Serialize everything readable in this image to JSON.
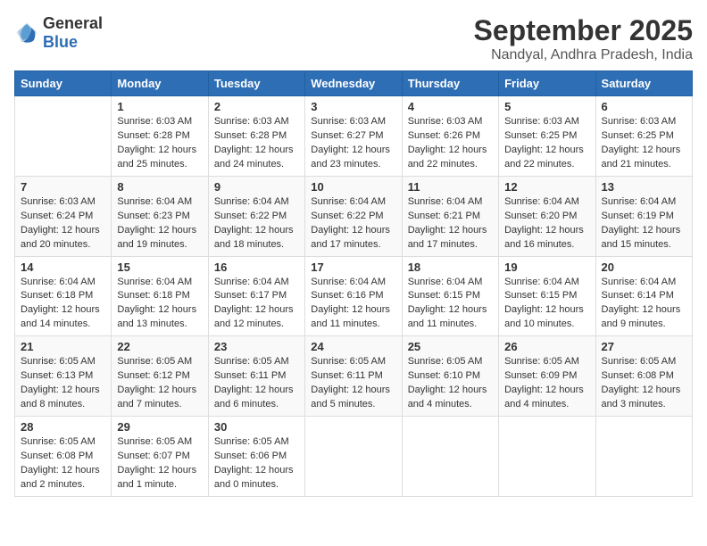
{
  "header": {
    "logo_general": "General",
    "logo_blue": "Blue",
    "month_title": "September 2025",
    "location": "Nandyal, Andhra Pradesh, India"
  },
  "weekdays": [
    "Sunday",
    "Monday",
    "Tuesday",
    "Wednesday",
    "Thursday",
    "Friday",
    "Saturday"
  ],
  "weeks": [
    [
      {
        "day": "",
        "sunrise": "",
        "sunset": "",
        "daylight": ""
      },
      {
        "day": "1",
        "sunrise": "Sunrise: 6:03 AM",
        "sunset": "Sunset: 6:28 PM",
        "daylight": "Daylight: 12 hours and 25 minutes."
      },
      {
        "day": "2",
        "sunrise": "Sunrise: 6:03 AM",
        "sunset": "Sunset: 6:28 PM",
        "daylight": "Daylight: 12 hours and 24 minutes."
      },
      {
        "day": "3",
        "sunrise": "Sunrise: 6:03 AM",
        "sunset": "Sunset: 6:27 PM",
        "daylight": "Daylight: 12 hours and 23 minutes."
      },
      {
        "day": "4",
        "sunrise": "Sunrise: 6:03 AM",
        "sunset": "Sunset: 6:26 PM",
        "daylight": "Daylight: 12 hours and 22 minutes."
      },
      {
        "day": "5",
        "sunrise": "Sunrise: 6:03 AM",
        "sunset": "Sunset: 6:25 PM",
        "daylight": "Daylight: 12 hours and 22 minutes."
      },
      {
        "day": "6",
        "sunrise": "Sunrise: 6:03 AM",
        "sunset": "Sunset: 6:25 PM",
        "daylight": "Daylight: 12 hours and 21 minutes."
      }
    ],
    [
      {
        "day": "7",
        "sunrise": "Sunrise: 6:03 AM",
        "sunset": "Sunset: 6:24 PM",
        "daylight": "Daylight: 12 hours and 20 minutes."
      },
      {
        "day": "8",
        "sunrise": "Sunrise: 6:04 AM",
        "sunset": "Sunset: 6:23 PM",
        "daylight": "Daylight: 12 hours and 19 minutes."
      },
      {
        "day": "9",
        "sunrise": "Sunrise: 6:04 AM",
        "sunset": "Sunset: 6:22 PM",
        "daylight": "Daylight: 12 hours and 18 minutes."
      },
      {
        "day": "10",
        "sunrise": "Sunrise: 6:04 AM",
        "sunset": "Sunset: 6:22 PM",
        "daylight": "Daylight: 12 hours and 17 minutes."
      },
      {
        "day": "11",
        "sunrise": "Sunrise: 6:04 AM",
        "sunset": "Sunset: 6:21 PM",
        "daylight": "Daylight: 12 hours and 17 minutes."
      },
      {
        "day": "12",
        "sunrise": "Sunrise: 6:04 AM",
        "sunset": "Sunset: 6:20 PM",
        "daylight": "Daylight: 12 hours and 16 minutes."
      },
      {
        "day": "13",
        "sunrise": "Sunrise: 6:04 AM",
        "sunset": "Sunset: 6:19 PM",
        "daylight": "Daylight: 12 hours and 15 minutes."
      }
    ],
    [
      {
        "day": "14",
        "sunrise": "Sunrise: 6:04 AM",
        "sunset": "Sunset: 6:18 PM",
        "daylight": "Daylight: 12 hours and 14 minutes."
      },
      {
        "day": "15",
        "sunrise": "Sunrise: 6:04 AM",
        "sunset": "Sunset: 6:18 PM",
        "daylight": "Daylight: 12 hours and 13 minutes."
      },
      {
        "day": "16",
        "sunrise": "Sunrise: 6:04 AM",
        "sunset": "Sunset: 6:17 PM",
        "daylight": "Daylight: 12 hours and 12 minutes."
      },
      {
        "day": "17",
        "sunrise": "Sunrise: 6:04 AM",
        "sunset": "Sunset: 6:16 PM",
        "daylight": "Daylight: 12 hours and 11 minutes."
      },
      {
        "day": "18",
        "sunrise": "Sunrise: 6:04 AM",
        "sunset": "Sunset: 6:15 PM",
        "daylight": "Daylight: 12 hours and 11 minutes."
      },
      {
        "day": "19",
        "sunrise": "Sunrise: 6:04 AM",
        "sunset": "Sunset: 6:15 PM",
        "daylight": "Daylight: 12 hours and 10 minutes."
      },
      {
        "day": "20",
        "sunrise": "Sunrise: 6:04 AM",
        "sunset": "Sunset: 6:14 PM",
        "daylight": "Daylight: 12 hours and 9 minutes."
      }
    ],
    [
      {
        "day": "21",
        "sunrise": "Sunrise: 6:05 AM",
        "sunset": "Sunset: 6:13 PM",
        "daylight": "Daylight: 12 hours and 8 minutes."
      },
      {
        "day": "22",
        "sunrise": "Sunrise: 6:05 AM",
        "sunset": "Sunset: 6:12 PM",
        "daylight": "Daylight: 12 hours and 7 minutes."
      },
      {
        "day": "23",
        "sunrise": "Sunrise: 6:05 AM",
        "sunset": "Sunset: 6:11 PM",
        "daylight": "Daylight: 12 hours and 6 minutes."
      },
      {
        "day": "24",
        "sunrise": "Sunrise: 6:05 AM",
        "sunset": "Sunset: 6:11 PM",
        "daylight": "Daylight: 12 hours and 5 minutes."
      },
      {
        "day": "25",
        "sunrise": "Sunrise: 6:05 AM",
        "sunset": "Sunset: 6:10 PM",
        "daylight": "Daylight: 12 hours and 4 minutes."
      },
      {
        "day": "26",
        "sunrise": "Sunrise: 6:05 AM",
        "sunset": "Sunset: 6:09 PM",
        "daylight": "Daylight: 12 hours and 4 minutes."
      },
      {
        "day": "27",
        "sunrise": "Sunrise: 6:05 AM",
        "sunset": "Sunset: 6:08 PM",
        "daylight": "Daylight: 12 hours and 3 minutes."
      }
    ],
    [
      {
        "day": "28",
        "sunrise": "Sunrise: 6:05 AM",
        "sunset": "Sunset: 6:08 PM",
        "daylight": "Daylight: 12 hours and 2 minutes."
      },
      {
        "day": "29",
        "sunrise": "Sunrise: 6:05 AM",
        "sunset": "Sunset: 6:07 PM",
        "daylight": "Daylight: 12 hours and 1 minute."
      },
      {
        "day": "30",
        "sunrise": "Sunrise: 6:05 AM",
        "sunset": "Sunset: 6:06 PM",
        "daylight": "Daylight: 12 hours and 0 minutes."
      },
      {
        "day": "",
        "sunrise": "",
        "sunset": "",
        "daylight": ""
      },
      {
        "day": "",
        "sunrise": "",
        "sunset": "",
        "daylight": ""
      },
      {
        "day": "",
        "sunrise": "",
        "sunset": "",
        "daylight": ""
      },
      {
        "day": "",
        "sunrise": "",
        "sunset": "",
        "daylight": ""
      }
    ]
  ]
}
